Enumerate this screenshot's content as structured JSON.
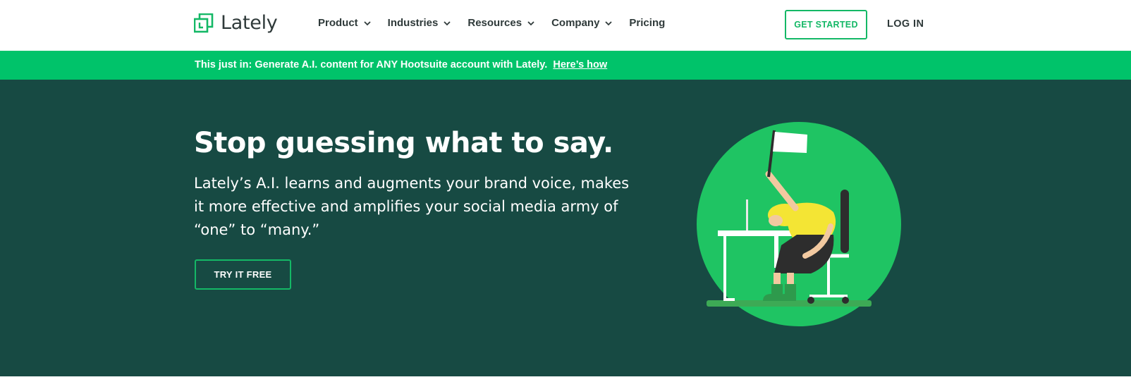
{
  "brand": {
    "name": "Lately",
    "accent_color": "#14b866",
    "banner_color": "#00c36a",
    "hero_bg_color": "#174a43"
  },
  "nav": {
    "items": [
      {
        "label": "Product",
        "has_dropdown": true
      },
      {
        "label": "Industries",
        "has_dropdown": true
      },
      {
        "label": "Resources",
        "has_dropdown": true
      },
      {
        "label": "Company",
        "has_dropdown": true
      },
      {
        "label": "Pricing",
        "has_dropdown": false
      }
    ],
    "get_started_label": "GET STARTED",
    "login_label": "LOG IN"
  },
  "announcement": {
    "text": "This just in: Generate A.I. content for ANY Hootsuite account with Lately.",
    "link_label": "Here’s how"
  },
  "hero": {
    "title": "Stop guessing what to say.",
    "body": "Lately’s A.I. learns and augments your brand voice, makes it more effective and amplifies your social media army of “one” to “many.”",
    "cta_label": "TRY IT FREE",
    "illustration": "person-at-desk-waving-white-flag"
  }
}
